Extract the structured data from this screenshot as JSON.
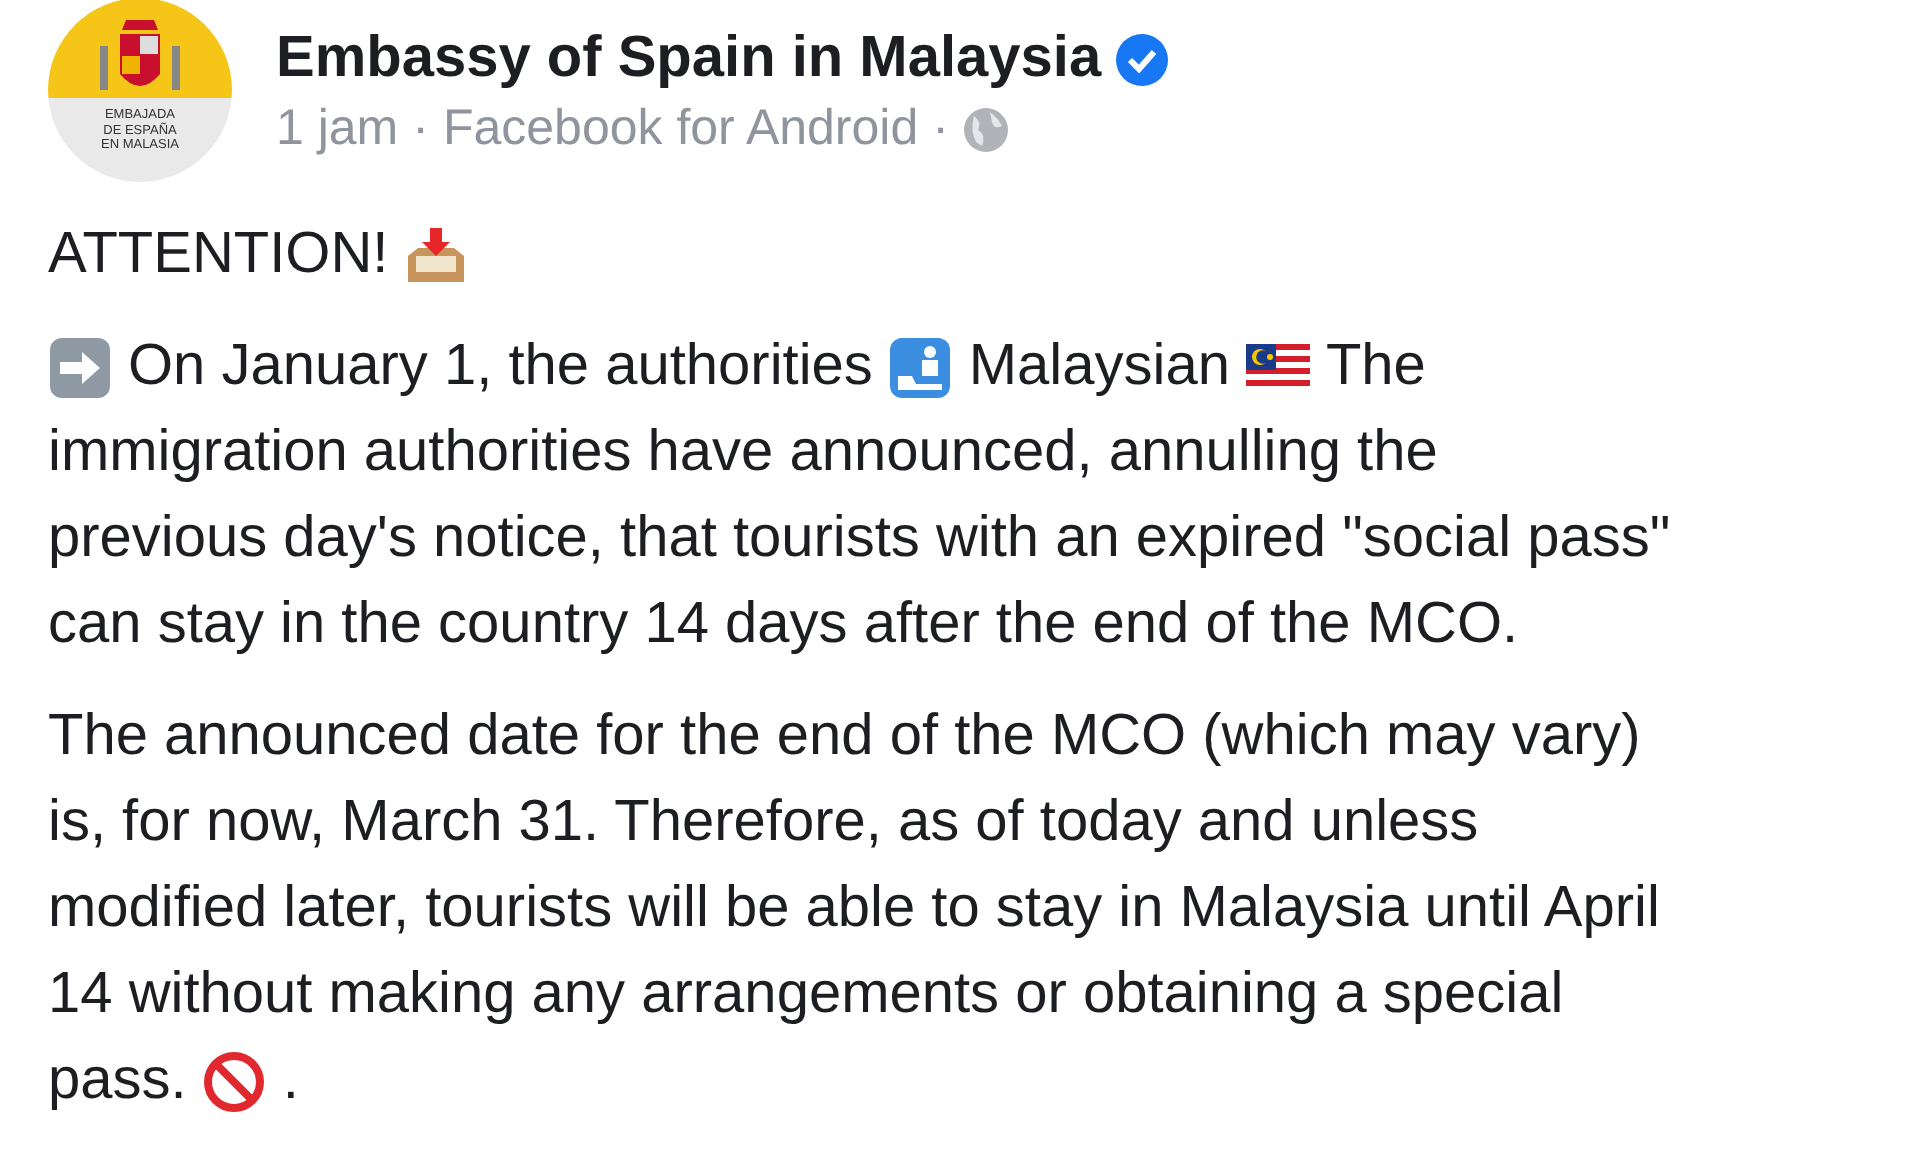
{
  "post": {
    "avatar": {
      "lines": [
        "EMBAJADA",
        "DE ESPAÑA",
        "EN MALASIA"
      ]
    },
    "author": "Embassy of Spain in Malaysia",
    "verified": true,
    "meta": {
      "time": "1 jam",
      "separator": "·",
      "source": "Facebook for Android",
      "separator_2": "·"
    },
    "paragraphs": [
      [
        [
          {
            "kind": "text",
            "text": "ATTENTION!"
          },
          {
            "kind": "tray"
          }
        ]
      ],
      [
        [
          {
            "kind": "arrow"
          },
          {
            "kind": "text",
            "text": "On January 1, the authorities"
          },
          {
            "kind": "customs"
          },
          {
            "kind": "text",
            "text": "Malaysian"
          },
          {
            "kind": "flag"
          },
          {
            "kind": "text",
            "text": "The"
          }
        ],
        [
          {
            "kind": "text",
            "text": "immigration authorities have announced, annulling the"
          }
        ],
        [
          {
            "kind": "text",
            "text": "previous day's notice, that tourists with an expired \"social pass\""
          }
        ],
        [
          {
            "kind": "text",
            "text": "can stay in the country 14 days after the end of the MCO."
          }
        ]
      ],
      [
        [
          {
            "kind": "text",
            "text": "The announced date for the end of the MCO (which may vary)"
          }
        ],
        [
          {
            "kind": "text",
            "text": "is, for now, March 31. Therefore, as of today and unless"
          }
        ],
        [
          {
            "kind": "text",
            "text": "modified later, tourists will be able to stay in Malaysia until April"
          }
        ],
        [
          {
            "kind": "text",
            "text": "14 without making any arrangements or obtaining a special"
          }
        ],
        [
          {
            "kind": "text",
            "text": "pass."
          },
          {
            "kind": "prohibited"
          },
          {
            "kind": "text",
            "text": "."
          }
        ]
      ]
    ]
  }
}
